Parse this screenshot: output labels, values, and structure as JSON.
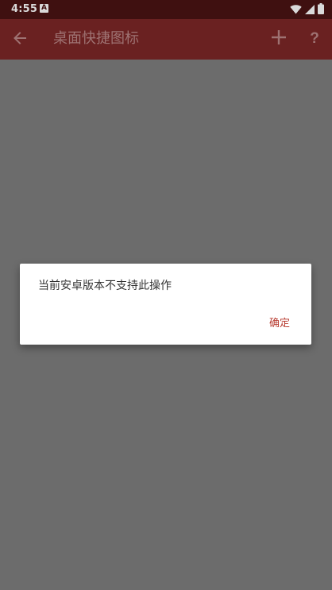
{
  "status_bar": {
    "time": "4:55",
    "notification_icon_letter": "A",
    "icons": [
      "wifi-icon",
      "cell-signal-icon",
      "battery-icon"
    ]
  },
  "app_bar": {
    "title": "桌面快捷图标",
    "back_icon": "arrow-left-icon",
    "add_icon": "plus-icon",
    "help_label": "?"
  },
  "dialog": {
    "message": "当前安卓版本不支持此操作",
    "ok_label": "确定"
  },
  "colors": {
    "status_bar": "#3f1010",
    "app_bar": "#6a2121",
    "scrim": "#6c6c6c",
    "accent": "#b73a2f",
    "dialog_bg": "#ffffff"
  }
}
